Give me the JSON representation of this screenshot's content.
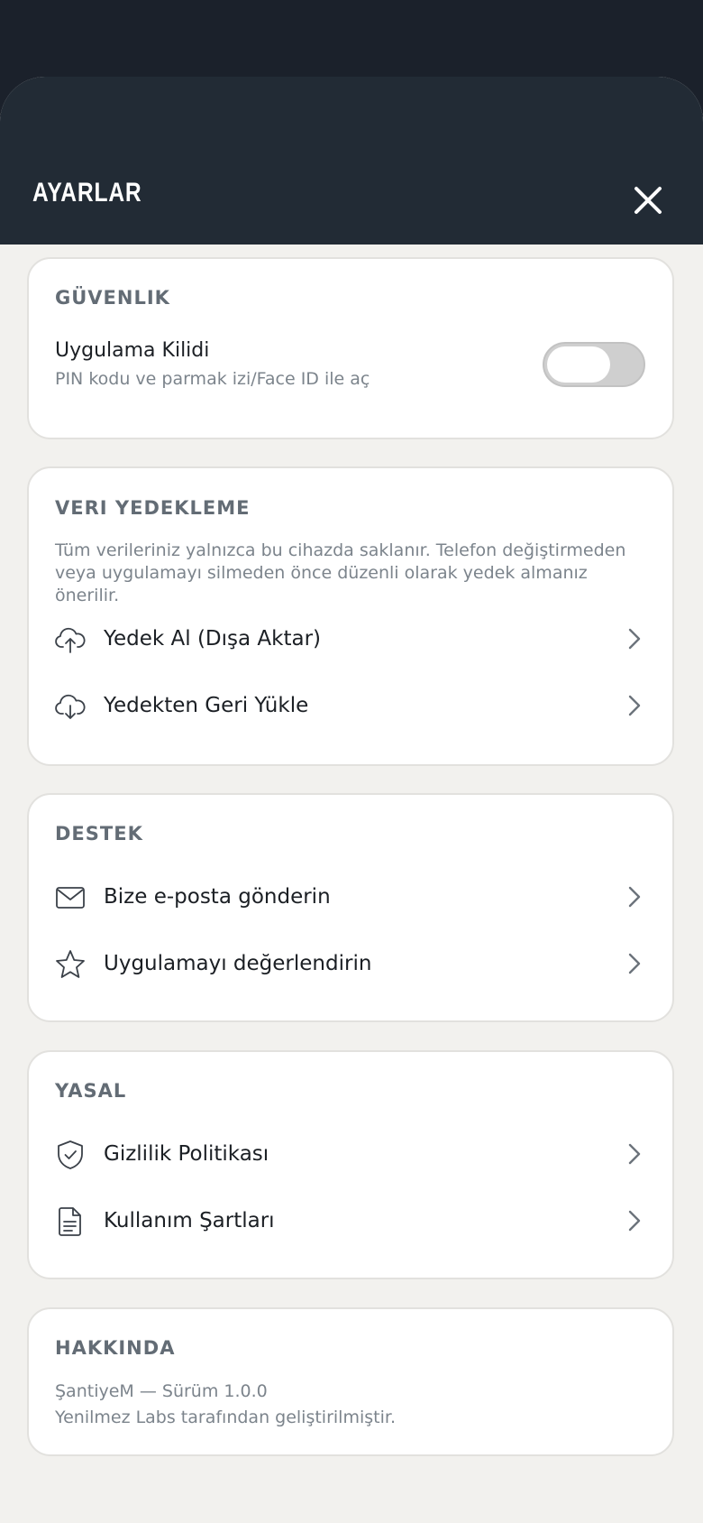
{
  "header": {
    "title": "AYARLAR"
  },
  "security": {
    "title": "GÜVENLIK",
    "app_lock_label": "Uygulama Kilidi",
    "app_lock_desc": "PIN kodu ve parmak izi/Face ID ile aç",
    "app_lock_enabled": false
  },
  "backup": {
    "title": "VERI YEDEKLEME",
    "desc": "Tüm verileriniz yalnızca bu cihazda saklanır. Telefon değiştirmeden veya uygulamayı silmeden önce düzenli olarak yedek almanız önerilir.",
    "items": [
      {
        "label": "Yedek Al (Dışa Aktar)",
        "icon": "cloud-upload-icon"
      },
      {
        "label": "Yedekten Geri Yükle",
        "icon": "cloud-download-icon"
      }
    ]
  },
  "support": {
    "title": "DESTEK",
    "items": [
      {
        "label": "Bize e-posta gönderin",
        "icon": "mail-icon"
      },
      {
        "label": "Uygulamayı değerlendirin",
        "icon": "star-icon"
      }
    ]
  },
  "legal": {
    "title": "YASAL",
    "items": [
      {
        "label": "Gizlilik Politikası",
        "icon": "shield-check-icon"
      },
      {
        "label": "Kullanım Şartları",
        "icon": "document-icon"
      }
    ]
  },
  "about": {
    "title": "HAKKINDA",
    "version_line": "ŞantiyeM — Sürüm 1.0.0",
    "developer_line": "Yenilmez Labs tarafından geliştirilmiştir."
  },
  "colors": {
    "background": "#1b212b",
    "header": "#222b35",
    "sheet": "#f2f1ee",
    "card": "#ffffff",
    "section_title": "#636c75"
  }
}
